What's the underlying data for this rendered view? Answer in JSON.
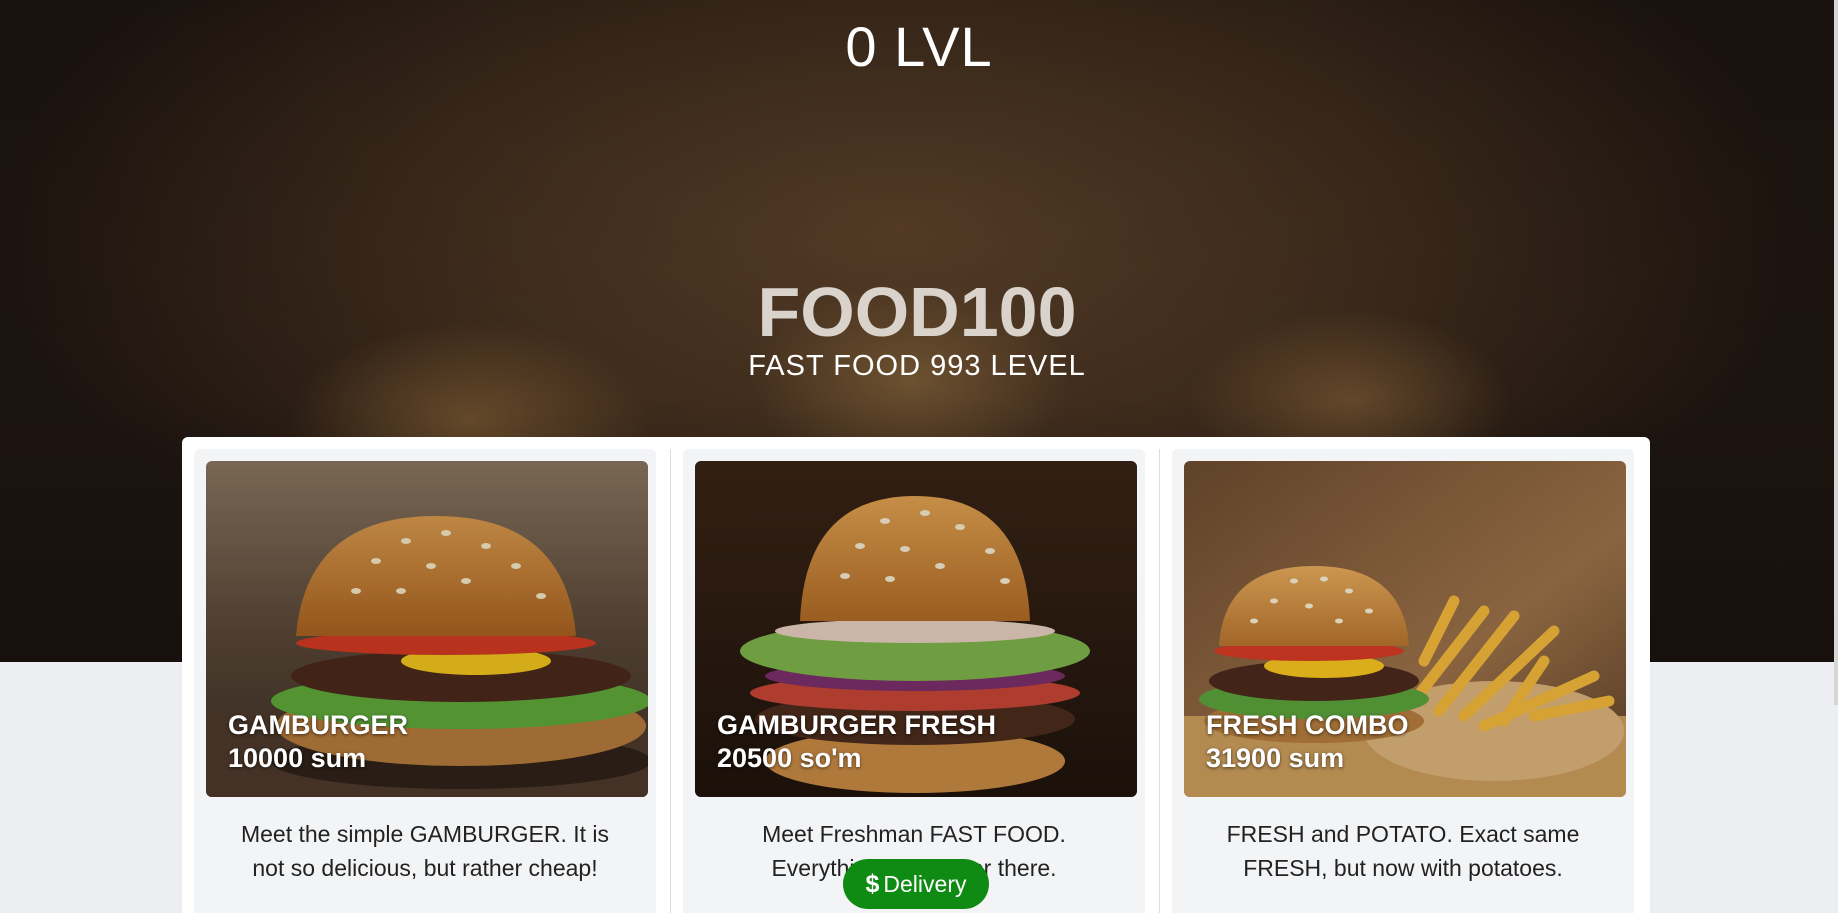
{
  "header": {
    "level_counter": "0 LVL"
  },
  "hero": {
    "title": "FOOD100",
    "subtitle": "FAST FOOD 993 LEVEL"
  },
  "cards": [
    {
      "name": "GAMBURGER",
      "price": "10000 sum",
      "description": "Meet the simple GAMBURGER. It is not so delicious, but rather cheap!"
    },
    {
      "name": "GAMBURGER FRESH",
      "price": "20500 so'm",
      "description": "Meet Freshman FAST FOOD. Everything old is over there."
    },
    {
      "name": "FRESH COMBO",
      "price": "31900 sum",
      "description": "FRESH and POTATO. Exact same FRESH, but now with potatoes."
    }
  ],
  "delivery_button": {
    "icon": "dollar-icon",
    "label": "Delivery",
    "color": "#0f8a12"
  }
}
